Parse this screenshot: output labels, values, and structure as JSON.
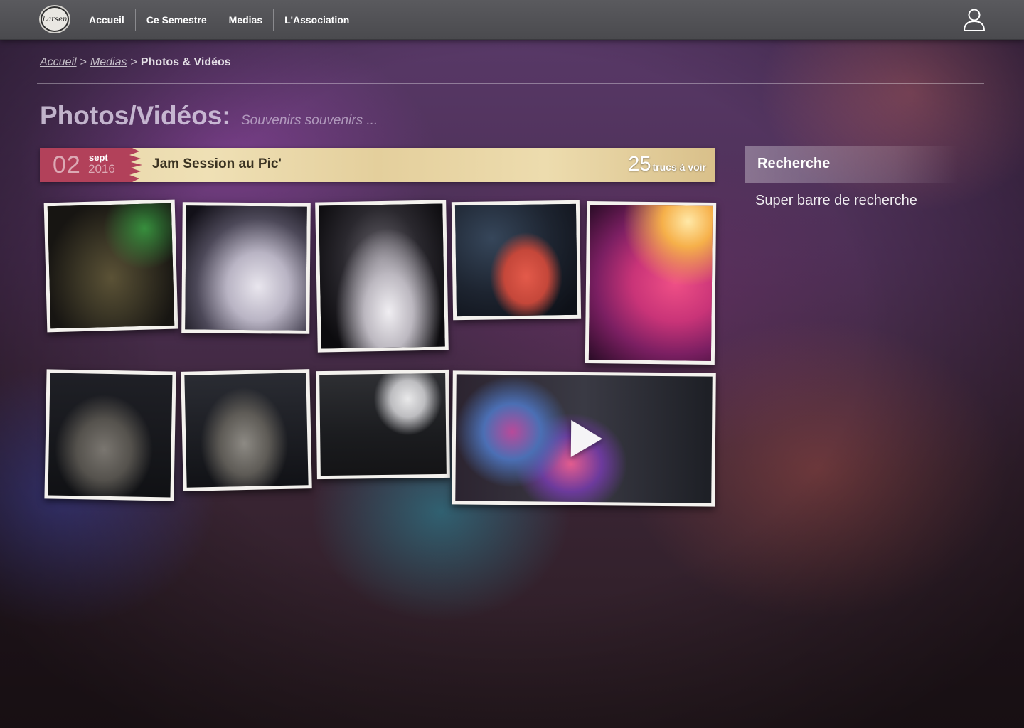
{
  "logo": {
    "text": "Larsen"
  },
  "nav": {
    "items": [
      {
        "label": "Accueil"
      },
      {
        "label": "Ce Semestre"
      },
      {
        "label": "Medias"
      },
      {
        "label": "L'Association"
      }
    ],
    "user_icon": "user-icon"
  },
  "breadcrumb": {
    "items": [
      "Accueil",
      "Medias"
    ],
    "separator": ">",
    "current": "Photos & Vidéos"
  },
  "page": {
    "title": "Photos/Vidéos:",
    "subtitle": "Souvenirs souvenirs ..."
  },
  "event": {
    "day": "02",
    "month": "sept",
    "year": "2016",
    "title": "Jam Session au Pic'",
    "count": "25",
    "count_label": "trucs à voir"
  },
  "photos": [
    {
      "kind": "photo",
      "subject": "masked-singer"
    },
    {
      "kind": "photo",
      "subject": "stage-smoke"
    },
    {
      "kind": "photo",
      "subject": "guitarist-arms-up"
    },
    {
      "kind": "photo",
      "subject": "singer-red-shirt"
    },
    {
      "kind": "photo",
      "subject": "guitarist-pink-lights"
    },
    {
      "kind": "photo",
      "subject": "trumpet-player"
    },
    {
      "kind": "photo",
      "subject": "bearded-singer"
    },
    {
      "kind": "photo",
      "subject": "acoustic-band"
    },
    {
      "kind": "video",
      "subject": "festival-stage",
      "play_icon": "play-icon"
    }
  ],
  "sidebar": {
    "title": "Recherche",
    "search_text": "Super barre de recherche"
  },
  "colors": {
    "topbar": "#4f4f53",
    "date_block": "#b2415a",
    "banner": "#e7d6a9"
  }
}
